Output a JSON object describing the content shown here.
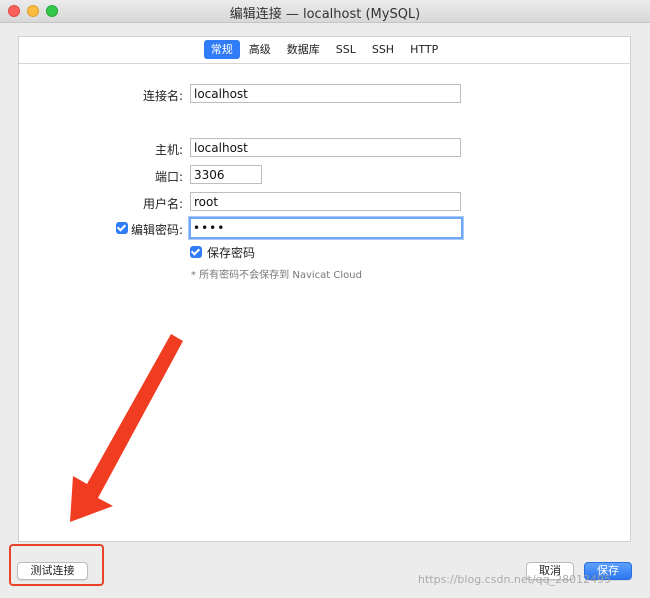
{
  "window": {
    "title": "编辑连接 — localhost (MySQL)"
  },
  "tabs": [
    {
      "label": "常规",
      "active": true
    },
    {
      "label": "高级",
      "active": false
    },
    {
      "label": "数据库",
      "active": false
    },
    {
      "label": "SSL",
      "active": false
    },
    {
      "label": "SSH",
      "active": false
    },
    {
      "label": "HTTP",
      "active": false
    }
  ],
  "form": {
    "connection_name_label": "连接名:",
    "connection_name_value": "localhost",
    "host_label": "主机:",
    "host_value": "localhost",
    "port_label": "端口:",
    "port_value": "3306",
    "username_label": "用户名:",
    "username_value": "root",
    "edit_password_label": "编辑密码:",
    "edit_password_checked": true,
    "password_value": "••••",
    "save_password_label": "保存密码",
    "save_password_checked": true,
    "password_hint": "* 所有密码不会保存到 Navicat Cloud"
  },
  "footer": {
    "test_connection_label": "测试连接",
    "cancel_label": "取消",
    "save_label": "保存"
  },
  "watermark": "https://blog.csdn.net/qq_28012495",
  "colors": {
    "accent": "#2f7cf6",
    "annotation": "#e8432a"
  }
}
